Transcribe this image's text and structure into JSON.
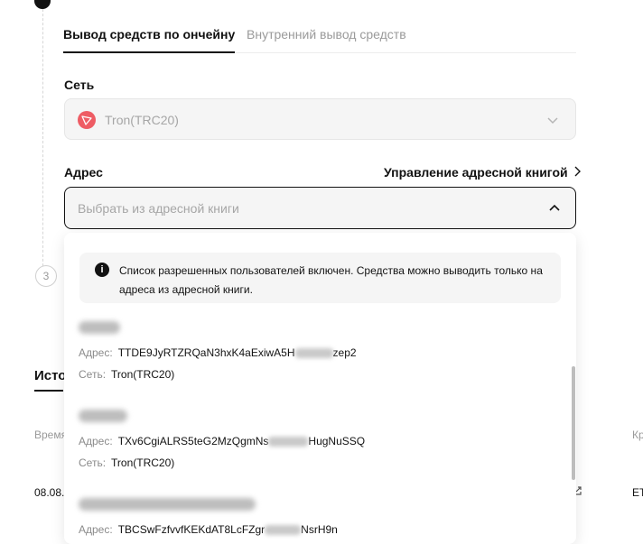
{
  "tabs": {
    "active": "Вывод средств по ончейну",
    "inactive": "Внутренний вывод средств"
  },
  "network": {
    "label": "Сеть",
    "value": "Tron(TRC20)"
  },
  "address": {
    "label": "Адрес",
    "manage_link": "Управление адресной книгой",
    "placeholder": "Выбрать из адресной книги"
  },
  "stepper": {
    "step3": "3"
  },
  "history": {
    "title": "Исто",
    "col_time": "Время",
    "row_date": "08.08.",
    "col_right": "Кр",
    "row_right": "ET"
  },
  "dropdown": {
    "notice": "Список разрешенных пользователей включен. Средства можно выводить только на адреса из адресной книги.",
    "address_key": "Адрес:",
    "network_key": "Сеть:",
    "entries": [
      {
        "addr_start": "TTDE9JyRTZRQaN3hxK4aExiwA5H",
        "addr_end": "zep2",
        "network": "Tron(TRC20)"
      },
      {
        "addr_start": "TXv6CgiALRS5teG2MzQgmNs",
        "addr_end": "HugNuSSQ",
        "network": "Tron(TRC20)"
      },
      {
        "addr_start": "TBCSwFzfvvfKEKdAT8LcFZgr",
        "addr_end": "NsrH9n",
        "network": ""
      }
    ]
  }
}
